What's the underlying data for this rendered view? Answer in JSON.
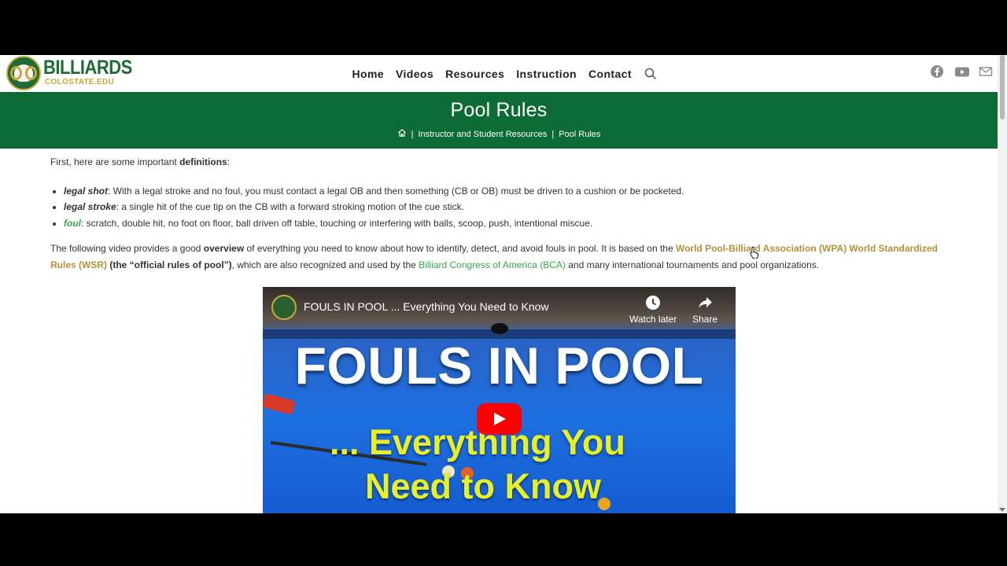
{
  "brand": {
    "title": "BILLIARDS",
    "subtitle": "COLOSTATE.EDU",
    "colors": {
      "green": "#0d6b36",
      "gold": "#c8a93a"
    }
  },
  "nav": {
    "items": [
      "Home",
      "Videos",
      "Resources",
      "Instruction",
      "Contact"
    ],
    "search_icon": "search-icon"
  },
  "social": [
    "facebook-icon",
    "youtube-icon",
    "mail-icon"
  ],
  "banner": {
    "title": "Pool Rules",
    "breadcrumb": [
      "Instructor and Student Resources",
      "Pool Rules"
    ],
    "separator": "|"
  },
  "content": {
    "intro": {
      "prefix": "First, here are some important ",
      "bold": "definitions",
      "suffix": ":"
    },
    "definitions": [
      {
        "term": "legal shot",
        "text": ": With a legal stroke and no foul, you must contact a legal OB and then something (CB or OB) must be driven to a cushion or be pocketed."
      },
      {
        "term": "legal stroke",
        "text": ": a single hit of the cue tip on the CB with a forward stroking motion of the cue stick."
      },
      {
        "term": "foul",
        "text": ": scratch, double hit, no foot on floor, ball driven off table, touching or interfering with balls, scoop, push, intentional miscue."
      }
    ],
    "overview": {
      "p1": "The following video provides a good ",
      "bold1": "overview",
      "p2": " of everything you need to know about how to identify, detect, and avoid fouls in pool. It is based on the ",
      "link1": "World Pool-Billiard Association (WPA) World Standardized Rules (WSR)",
      "bold2": " (the “official rules of pool”)",
      "p3": ", which are also recognized and used by the ",
      "link2": "Billiard Congress of America (BCA)",
      "p4": " and many international tournaments and pool organizations."
    }
  },
  "video": {
    "title": "FOULS IN POOL ... Everything You Need to Know",
    "watch_later": "Watch later",
    "share": "Share",
    "headline": "FOULS IN POOL",
    "subline_1": "... Everything You",
    "subline_2": "Need to Know"
  }
}
